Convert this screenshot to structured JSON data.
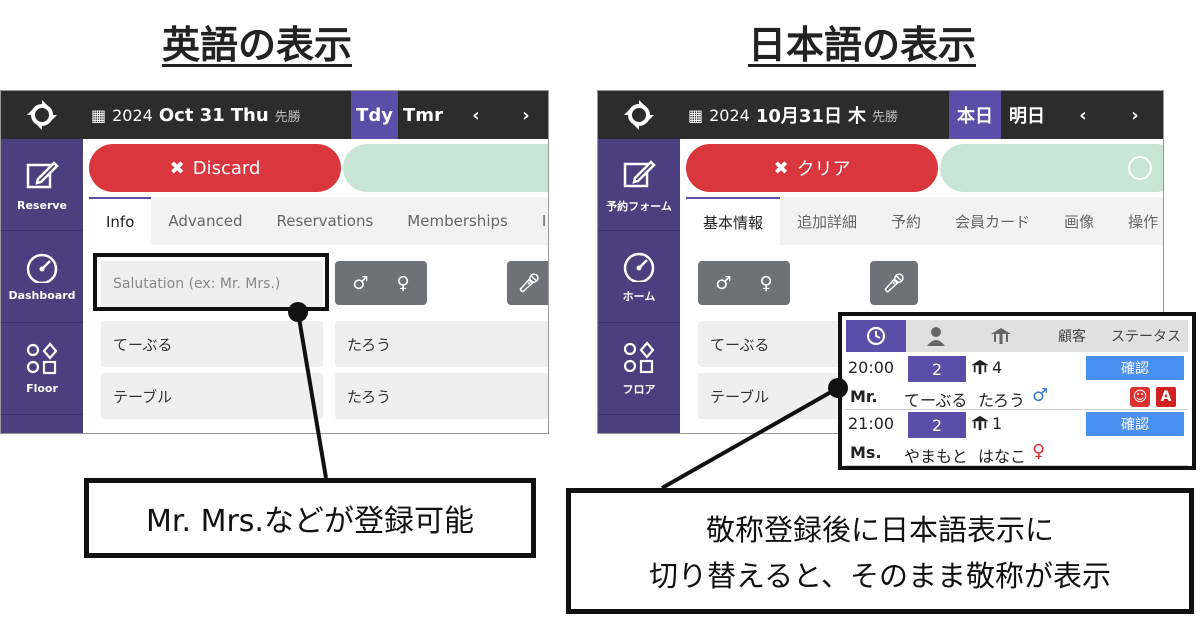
{
  "titles": {
    "left": "英語の表示",
    "right": "日本語の表示"
  },
  "colors": {
    "topbar": "#2c2c2c",
    "sidebar": "#4b3f7f",
    "accent": "#5b4ea8",
    "discard": "#d9363e",
    "confirm": "#4b8ff0"
  },
  "english": {
    "date": {
      "year": "2024",
      "date": "Oct 31",
      "weekday": "Thu",
      "rokuyo": "先勝"
    },
    "today_label": "Tdy",
    "tomorrow_label": "Tmr",
    "sidebar": [
      {
        "label": "Reserve",
        "icon": "edit-icon"
      },
      {
        "label": "Dashboard",
        "icon": "gauge-icon"
      },
      {
        "label": "Floor",
        "icon": "shapes-icon"
      }
    ],
    "discard_label": "Discard",
    "tabs": [
      "Info",
      "Advanced",
      "Reservations",
      "Memberships",
      "I"
    ],
    "salutation_placeholder": "Salutation (ex: Mr. Mrs.)",
    "fields": {
      "last_kana": "てーぶる",
      "first_kana": "たろう",
      "last_name": "テーブル",
      "first_name": "たろう"
    }
  },
  "japanese": {
    "date": {
      "year": "2024",
      "date": "10月31日",
      "weekday": "木",
      "rokuyo": "先勝"
    },
    "today_label": "本日",
    "tomorrow_label": "明日",
    "sidebar": [
      {
        "label": "予約フォーム",
        "icon": "edit-icon"
      },
      {
        "label": "ホーム",
        "icon": "gauge-icon"
      },
      {
        "label": "フロア",
        "icon": "shapes-icon"
      }
    ],
    "discard_label": "クリア",
    "tabs": [
      "基本情報",
      "追加詳細",
      "予約",
      "会員カード",
      "画像",
      "操作"
    ],
    "fields": {
      "last_kana": "てーぶる",
      "last_name": "テーブル"
    }
  },
  "reservation_list": {
    "headers": {
      "customer": "顧客",
      "status": "ステータス"
    },
    "rows": [
      {
        "time": "20:00",
        "party": "2",
        "table": "4",
        "salutation": "Mr.",
        "last": "てーぶる",
        "first": "たろう",
        "gender": "♂",
        "status": "確認",
        "badge": "A"
      },
      {
        "time": "21:00",
        "party": "2",
        "table": "1",
        "salutation": "Ms.",
        "last": "やまもと",
        "first": "はなこ",
        "gender": "♀",
        "status": "確認"
      }
    ]
  },
  "callouts": {
    "left": "Mr. Mrs.などが登録可能",
    "right_line1": "敬称登録後に日本語表示に",
    "right_line2": "切り替えると、そのまま敬称が表示"
  }
}
